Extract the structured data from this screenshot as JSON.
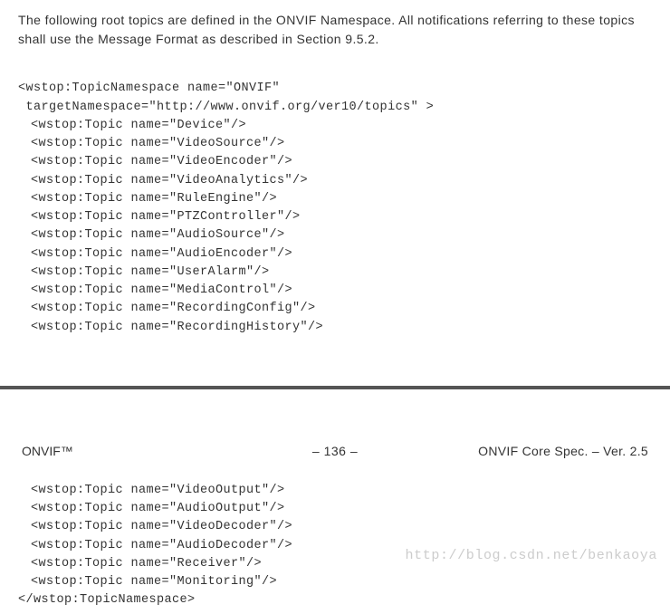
{
  "intro": "The following root topics are defined in the ONVIF Namespace. All notifications referring to these topics shall use the Message Format as described in Section 9.5.2.",
  "code1": {
    "line1": "<wstop:TopicNamespace name=\"ONVIF\"",
    "line2": " targetNamespace=\"http://www.onvif.org/ver10/topics\" >",
    "topics": [
      "<wstop:Topic name=\"Device\"/>",
      "<wstop:Topic name=\"VideoSource\"/>",
      "<wstop:Topic name=\"VideoEncoder\"/>",
      "<wstop:Topic name=\"VideoAnalytics\"/>",
      "<wstop:Topic name=\"RuleEngine\"/>",
      "<wstop:Topic name=\"PTZController\"/>",
      "<wstop:Topic name=\"AudioSource\"/>",
      "<wstop:Topic name=\"AudioEncoder\"/>",
      "<wstop:Topic name=\"UserAlarm\"/>",
      "<wstop:Topic name=\"MediaControl\"/>",
      "<wstop:Topic name=\"RecordingConfig\"/>",
      "<wstop:Topic name=\"RecordingHistory\"/>"
    ]
  },
  "footer": {
    "left": "ONVIF™",
    "center": "– 136 –",
    "right": "ONVIF Core Spec. – Ver. 2.5"
  },
  "code2": {
    "topics": [
      "<wstop:Topic name=\"VideoOutput\"/>",
      "<wstop:Topic name=\"AudioOutput\"/>",
      "<wstop:Topic name=\"VideoDecoder\"/>",
      "<wstop:Topic name=\"AudioDecoder\"/>",
      "<wstop:Topic name=\"Receiver\"/>",
      "<wstop:Topic name=\"Monitoring\"/>"
    ],
    "closing": "</wstop:TopicNamespace>"
  },
  "watermark": "http://blog.csdn.net/benkaoya"
}
